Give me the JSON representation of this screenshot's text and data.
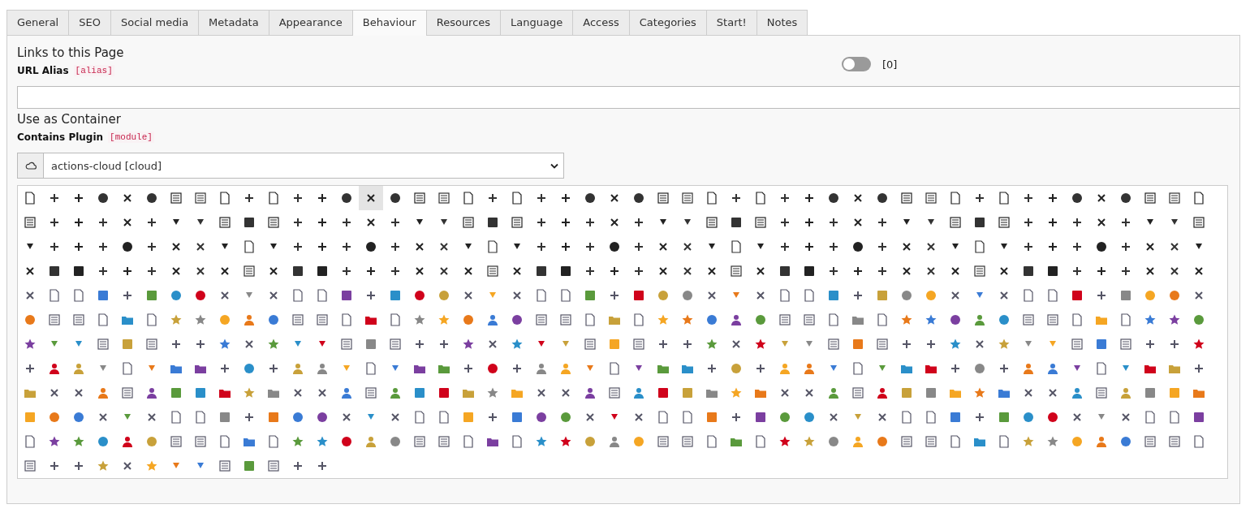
{
  "tabs": [
    {
      "label": "General",
      "selected": false
    },
    {
      "label": "SEO",
      "selected": false
    },
    {
      "label": "Social media",
      "selected": false
    },
    {
      "label": "Metadata",
      "selected": false
    },
    {
      "label": "Appearance",
      "selected": false
    },
    {
      "label": "Behaviour",
      "selected": true
    },
    {
      "label": "Resources",
      "selected": false
    },
    {
      "label": "Language",
      "selected": false
    },
    {
      "label": "Access",
      "selected": false
    },
    {
      "label": "Categories",
      "selected": false
    },
    {
      "label": "Start!",
      "selected": false
    },
    {
      "label": "Notes",
      "selected": false
    }
  ],
  "links_section": {
    "heading": "Links to this Page",
    "field_label": "URL Alias",
    "field_name": "[alias]",
    "toggle": {
      "on": false,
      "value_label": "[0]"
    }
  },
  "container_section": {
    "heading": "Use as Container",
    "field_label": "Contains Plugin",
    "field_name": "[module]",
    "select_value": "actions-cloud [cloud]"
  },
  "icon_grid": {
    "rows": [
      {
        "icons": [
          {
            "selected": false
          },
          {
            "selected": false
          },
          {
            "selected": false
          },
          {
            "selected": false
          },
          {
            "selected": false
          },
          {
            "selected": false
          },
          {
            "selected": false
          },
          {
            "selected": false
          },
          {
            "selected": false
          },
          {
            "selected": false
          },
          {
            "selected": false
          },
          {
            "selected": false
          },
          {
            "selected": false
          },
          {
            "selected": false
          },
          {
            "selected": true
          },
          {
            "selected": false
          },
          {
            "selected": false
          },
          {
            "selected": false
          },
          {
            "selected": false
          },
          {
            "selected": false
          },
          {
            "selected": false
          },
          {
            "selected": false
          },
          {
            "selected": false
          },
          {
            "selected": false
          },
          {
            "selected": false
          },
          {
            "selected": false
          },
          {
            "selected": false
          },
          {
            "selected": false
          },
          {
            "selected": false
          },
          {
            "selected": false
          },
          {
            "selected": false
          },
          {
            "selected": false
          },
          {
            "selected": false
          },
          {
            "selected": false
          },
          {
            "selected": false
          },
          {
            "selected": false
          },
          {
            "selected": false
          },
          {
            "selected": false
          },
          {
            "selected": false
          },
          {
            "selected": false
          },
          {
            "selected": false
          },
          {
            "selected": false
          },
          {
            "selected": false
          },
          {
            "selected": false
          },
          {
            "selected": false
          },
          {
            "selected": false
          },
          {
            "selected": false
          },
          {
            "selected": false
          },
          {
            "selected": false
          }
        ]
      },
      {
        "icons": [
          {
            "selected": false
          },
          {
            "selected": false
          },
          {
            "selected": false
          },
          {
            "selected": false
          },
          {
            "selected": false
          },
          {
            "selected": false
          },
          {
            "selected": false
          },
          {
            "selected": false
          },
          {
            "selected": false
          },
          {
            "selected": false
          },
          {
            "selected": false
          },
          {
            "selected": false
          },
          {
            "selected": false
          },
          {
            "selected": false
          },
          {
            "selected": false
          },
          {
            "selected": false
          },
          {
            "selected": false
          },
          {
            "selected": false
          },
          {
            "selected": false
          },
          {
            "selected": false
          },
          {
            "selected": false
          },
          {
            "selected": false
          },
          {
            "selected": false
          },
          {
            "selected": false
          },
          {
            "selected": false
          },
          {
            "selected": false
          },
          {
            "selected": false
          },
          {
            "selected": false
          },
          {
            "selected": false
          },
          {
            "selected": false
          },
          {
            "selected": false
          },
          {
            "selected": false
          },
          {
            "selected": false
          },
          {
            "selected": false
          },
          {
            "selected": false
          },
          {
            "selected": false
          },
          {
            "selected": false
          },
          {
            "selected": false
          },
          {
            "selected": false
          },
          {
            "selected": false
          },
          {
            "selected": false
          },
          {
            "selected": false
          },
          {
            "selected": false
          },
          {
            "selected": false
          },
          {
            "selected": false
          },
          {
            "selected": false
          },
          {
            "selected": false
          },
          {
            "selected": false
          },
          {
            "selected": false
          }
        ]
      },
      {
        "icons": [
          {
            "selected": false
          },
          {
            "selected": false
          },
          {
            "selected": false
          },
          {
            "selected": false
          },
          {
            "selected": false
          },
          {
            "selected": false
          },
          {
            "selected": false
          },
          {
            "selected": false
          },
          {
            "selected": false
          },
          {
            "selected": false
          },
          {
            "selected": false
          },
          {
            "selected": false
          },
          {
            "selected": false
          },
          {
            "selected": false
          },
          {
            "selected": false
          },
          {
            "selected": false
          },
          {
            "selected": false
          },
          {
            "selected": false
          },
          {
            "selected": false
          },
          {
            "selected": false
          },
          {
            "selected": false
          },
          {
            "selected": false
          },
          {
            "selected": false
          },
          {
            "selected": false
          },
          {
            "selected": false
          },
          {
            "selected": false
          },
          {
            "selected": false
          },
          {
            "selected": false
          },
          {
            "selected": false
          },
          {
            "selected": false
          },
          {
            "selected": false
          },
          {
            "selected": false
          },
          {
            "selected": false
          },
          {
            "selected": false
          },
          {
            "selected": false
          },
          {
            "selected": false
          },
          {
            "selected": false
          },
          {
            "selected": false
          },
          {
            "selected": false
          },
          {
            "selected": false
          },
          {
            "selected": false
          },
          {
            "selected": false
          },
          {
            "selected": false
          },
          {
            "selected": false
          },
          {
            "selected": false
          },
          {
            "selected": false
          },
          {
            "selected": false
          },
          {
            "selected": false
          },
          {
            "selected": false
          }
        ]
      },
      {
        "icons": [
          {
            "selected": false
          },
          {
            "selected": false
          },
          {
            "selected": false
          },
          {
            "selected": false
          },
          {
            "selected": false
          },
          {
            "selected": false
          },
          {
            "selected": false
          },
          {
            "selected": false
          },
          {
            "selected": false
          },
          {
            "selected": false
          },
          {
            "selected": false
          },
          {
            "selected": false
          },
          {
            "selected": false
          },
          {
            "selected": false
          },
          {
            "selected": false
          },
          {
            "selected": false
          },
          {
            "selected": false
          },
          {
            "selected": false
          },
          {
            "selected": false
          },
          {
            "selected": false
          },
          {
            "selected": false
          },
          {
            "selected": false
          },
          {
            "selected": false
          },
          {
            "selected": false
          },
          {
            "selected": false
          },
          {
            "selected": false
          },
          {
            "selected": false
          },
          {
            "selected": false
          },
          {
            "selected": false
          },
          {
            "selected": false
          },
          {
            "selected": false
          },
          {
            "selected": false
          },
          {
            "selected": false
          },
          {
            "selected": false
          },
          {
            "selected": false
          },
          {
            "selected": false
          },
          {
            "selected": false
          },
          {
            "selected": false
          },
          {
            "selected": false
          },
          {
            "selected": false
          },
          {
            "selected": false
          },
          {
            "selected": false
          },
          {
            "selected": false
          },
          {
            "selected": false
          },
          {
            "selected": false
          },
          {
            "selected": false
          },
          {
            "selected": false
          },
          {
            "selected": false
          },
          {
            "selected": false
          }
        ]
      },
      {
        "icons": [
          {
            "selected": false
          },
          {
            "selected": false
          },
          {
            "selected": false
          },
          {
            "selected": false
          },
          {
            "selected": false
          },
          {
            "selected": false
          },
          {
            "selected": false
          },
          {
            "selected": false
          },
          {
            "selected": false
          },
          {
            "selected": false
          },
          {
            "selected": false
          },
          {
            "selected": false
          },
          {
            "selected": false
          },
          {
            "selected": false
          },
          {
            "selected": false
          },
          {
            "selected": false
          },
          {
            "selected": false
          },
          {
            "selected": false
          },
          {
            "selected": false
          },
          {
            "selected": false
          },
          {
            "selected": false
          },
          {
            "selected": false
          },
          {
            "selected": false
          },
          {
            "selected": false
          },
          {
            "selected": false
          },
          {
            "selected": false
          },
          {
            "selected": false
          },
          {
            "selected": false
          },
          {
            "selected": false
          },
          {
            "selected": false
          },
          {
            "selected": false
          },
          {
            "selected": false
          },
          {
            "selected": false
          },
          {
            "selected": false
          },
          {
            "selected": false
          },
          {
            "selected": false
          },
          {
            "selected": false
          },
          {
            "selected": false
          },
          {
            "selected": false
          },
          {
            "selected": false
          },
          {
            "selected": false
          },
          {
            "selected": false
          },
          {
            "selected": false
          },
          {
            "selected": false
          },
          {
            "selected": false
          },
          {
            "selected": false
          },
          {
            "selected": false
          },
          {
            "selected": false
          },
          {
            "selected": false
          }
        ]
      },
      {
        "icons": [
          {
            "selected": false
          },
          {
            "selected": false
          },
          {
            "selected": false
          },
          {
            "selected": false
          },
          {
            "selected": false
          },
          {
            "selected": false
          },
          {
            "selected": false
          },
          {
            "selected": false
          },
          {
            "selected": false
          },
          {
            "selected": false
          },
          {
            "selected": false
          },
          {
            "selected": false
          },
          {
            "selected": false
          },
          {
            "selected": false
          },
          {
            "selected": false
          },
          {
            "selected": false
          },
          {
            "selected": false
          },
          {
            "selected": false
          },
          {
            "selected": false
          },
          {
            "selected": false
          },
          {
            "selected": false
          },
          {
            "selected": false
          },
          {
            "selected": false
          },
          {
            "selected": false
          },
          {
            "selected": false
          },
          {
            "selected": false
          },
          {
            "selected": false
          },
          {
            "selected": false
          },
          {
            "selected": false
          },
          {
            "selected": false
          },
          {
            "selected": false
          },
          {
            "selected": false
          },
          {
            "selected": false
          },
          {
            "selected": false
          },
          {
            "selected": false
          },
          {
            "selected": false
          },
          {
            "selected": false
          },
          {
            "selected": false
          },
          {
            "selected": false
          },
          {
            "selected": false
          },
          {
            "selected": false
          },
          {
            "selected": false
          },
          {
            "selected": false
          },
          {
            "selected": false
          },
          {
            "selected": false
          },
          {
            "selected": false
          },
          {
            "selected": false
          },
          {
            "selected": false
          },
          {
            "selected": false
          }
        ]
      },
      {
        "icons": [
          {
            "selected": false
          },
          {
            "selected": false
          },
          {
            "selected": false
          },
          {
            "selected": false
          },
          {
            "selected": false
          },
          {
            "selected": false
          },
          {
            "selected": false
          },
          {
            "selected": false
          },
          {
            "selected": false
          },
          {
            "selected": false
          },
          {
            "selected": false
          },
          {
            "selected": false
          },
          {
            "selected": false
          },
          {
            "selected": false
          },
          {
            "selected": false
          },
          {
            "selected": false
          },
          {
            "selected": false
          },
          {
            "selected": false
          },
          {
            "selected": false
          },
          {
            "selected": false
          },
          {
            "selected": false
          },
          {
            "selected": false
          },
          {
            "selected": false
          },
          {
            "selected": false
          },
          {
            "selected": false
          },
          {
            "selected": false
          },
          {
            "selected": false
          },
          {
            "selected": false
          },
          {
            "selected": false
          },
          {
            "selected": false
          },
          {
            "selected": false
          },
          {
            "selected": false
          },
          {
            "selected": false
          },
          {
            "selected": false
          },
          {
            "selected": false
          },
          {
            "selected": false
          },
          {
            "selected": false
          },
          {
            "selected": false
          },
          {
            "selected": false
          },
          {
            "selected": false
          },
          {
            "selected": false
          },
          {
            "selected": false
          },
          {
            "selected": false
          },
          {
            "selected": false
          },
          {
            "selected": false
          },
          {
            "selected": false
          },
          {
            "selected": false
          },
          {
            "selected": false
          },
          {
            "selected": false
          }
        ]
      },
      {
        "icons": [
          {
            "selected": false
          },
          {
            "selected": false
          },
          {
            "selected": false
          },
          {
            "selected": false
          },
          {
            "selected": false
          },
          {
            "selected": false
          },
          {
            "selected": false
          },
          {
            "selected": false
          },
          {
            "selected": false
          },
          {
            "selected": false
          },
          {
            "selected": false
          },
          {
            "selected": false
          },
          {
            "selected": false
          },
          {
            "selected": false
          },
          {
            "selected": false
          },
          {
            "selected": false
          },
          {
            "selected": false
          },
          {
            "selected": false
          },
          {
            "selected": false
          },
          {
            "selected": false
          },
          {
            "selected": false
          },
          {
            "selected": false
          },
          {
            "selected": false
          },
          {
            "selected": false
          },
          {
            "selected": false
          },
          {
            "selected": false
          },
          {
            "selected": false
          },
          {
            "selected": false
          },
          {
            "selected": false
          },
          {
            "selected": false
          },
          {
            "selected": false
          },
          {
            "selected": false
          },
          {
            "selected": false
          },
          {
            "selected": false
          },
          {
            "selected": false
          },
          {
            "selected": false
          },
          {
            "selected": false
          },
          {
            "selected": false
          },
          {
            "selected": false
          },
          {
            "selected": false
          },
          {
            "selected": false
          },
          {
            "selected": false
          },
          {
            "selected": false
          },
          {
            "selected": false
          },
          {
            "selected": false
          },
          {
            "selected": false
          },
          {
            "selected": false
          },
          {
            "selected": false
          },
          {
            "selected": false
          }
        ]
      },
      {
        "icons": [
          {
            "selected": false
          },
          {
            "selected": false
          },
          {
            "selected": false
          },
          {
            "selected": false
          },
          {
            "selected": false
          },
          {
            "selected": false
          },
          {
            "selected": false
          },
          {
            "selected": false
          },
          {
            "selected": false
          },
          {
            "selected": false
          },
          {
            "selected": false
          },
          {
            "selected": false
          },
          {
            "selected": false
          },
          {
            "selected": false
          },
          {
            "selected": false
          },
          {
            "selected": false
          },
          {
            "selected": false
          },
          {
            "selected": false
          },
          {
            "selected": false
          },
          {
            "selected": false
          },
          {
            "selected": false
          },
          {
            "selected": false
          },
          {
            "selected": false
          },
          {
            "selected": false
          },
          {
            "selected": false
          },
          {
            "selected": false
          },
          {
            "selected": false
          },
          {
            "selected": false
          },
          {
            "selected": false
          },
          {
            "selected": false
          },
          {
            "selected": false
          },
          {
            "selected": false
          },
          {
            "selected": false
          },
          {
            "selected": false
          },
          {
            "selected": false
          },
          {
            "selected": false
          },
          {
            "selected": false
          },
          {
            "selected": false
          },
          {
            "selected": false
          },
          {
            "selected": false
          },
          {
            "selected": false
          },
          {
            "selected": false
          },
          {
            "selected": false
          },
          {
            "selected": false
          },
          {
            "selected": false
          },
          {
            "selected": false
          },
          {
            "selected": false
          },
          {
            "selected": false
          },
          {
            "selected": false
          }
        ]
      },
      {
        "icons": [
          {
            "selected": false
          },
          {
            "selected": false
          },
          {
            "selected": false
          },
          {
            "selected": false
          },
          {
            "selected": false
          },
          {
            "selected": false
          },
          {
            "selected": false
          },
          {
            "selected": false
          },
          {
            "selected": false
          },
          {
            "selected": false
          },
          {
            "selected": false
          },
          {
            "selected": false
          },
          {
            "selected": false
          },
          {
            "selected": false
          },
          {
            "selected": false
          },
          {
            "selected": false
          },
          {
            "selected": false
          },
          {
            "selected": false
          },
          {
            "selected": false
          },
          {
            "selected": false
          },
          {
            "selected": false
          },
          {
            "selected": false
          },
          {
            "selected": false
          },
          {
            "selected": false
          },
          {
            "selected": false
          },
          {
            "selected": false
          },
          {
            "selected": false
          },
          {
            "selected": false
          },
          {
            "selected": false
          },
          {
            "selected": false
          },
          {
            "selected": false
          },
          {
            "selected": false
          },
          {
            "selected": false
          },
          {
            "selected": false
          },
          {
            "selected": false
          },
          {
            "selected": false
          },
          {
            "selected": false
          },
          {
            "selected": false
          },
          {
            "selected": false
          },
          {
            "selected": false
          },
          {
            "selected": false
          },
          {
            "selected": false
          },
          {
            "selected": false
          },
          {
            "selected": false
          },
          {
            "selected": false
          },
          {
            "selected": false
          },
          {
            "selected": false
          },
          {
            "selected": false
          },
          {
            "selected": false
          }
        ]
      },
      {
        "icons": [
          {
            "selected": false
          },
          {
            "selected": false
          },
          {
            "selected": false
          },
          {
            "selected": false
          },
          {
            "selected": false
          },
          {
            "selected": false
          },
          {
            "selected": false
          },
          {
            "selected": false
          },
          {
            "selected": false
          },
          {
            "selected": false
          },
          {
            "selected": false
          },
          {
            "selected": false
          },
          {
            "selected": false
          },
          {
            "selected": false
          },
          {
            "selected": false
          },
          {
            "selected": false
          },
          {
            "selected": false
          },
          {
            "selected": false
          },
          {
            "selected": false
          },
          {
            "selected": false
          },
          {
            "selected": false
          },
          {
            "selected": false
          },
          {
            "selected": false
          },
          {
            "selected": false
          },
          {
            "selected": false
          },
          {
            "selected": false
          },
          {
            "selected": false
          },
          {
            "selected": false
          },
          {
            "selected": false
          },
          {
            "selected": false
          },
          {
            "selected": false
          },
          {
            "selected": false
          },
          {
            "selected": false
          },
          {
            "selected": false
          },
          {
            "selected": false
          },
          {
            "selected": false
          },
          {
            "selected": false
          },
          {
            "selected": false
          },
          {
            "selected": false
          },
          {
            "selected": false
          },
          {
            "selected": false
          },
          {
            "selected": false
          },
          {
            "selected": false
          },
          {
            "selected": false
          },
          {
            "selected": false
          },
          {
            "selected": false
          },
          {
            "selected": false
          },
          {
            "selected": false
          },
          {
            "selected": false
          }
        ]
      },
      {
        "icons": [
          {
            "selected": false
          },
          {
            "selected": false
          },
          {
            "selected": false
          },
          {
            "selected": false
          },
          {
            "selected": false
          },
          {
            "selected": false
          },
          {
            "selected": false
          },
          {
            "selected": false
          },
          {
            "selected": false
          },
          {
            "selected": false
          },
          {
            "selected": false
          },
          {
            "selected": false
          },
          {
            "selected": false
          }
        ]
      }
    ]
  }
}
